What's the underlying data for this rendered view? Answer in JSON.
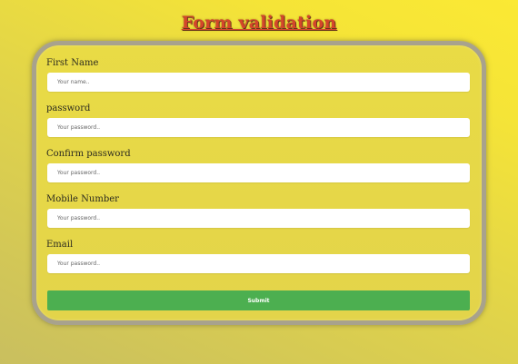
{
  "header": {
    "title": "Form validation"
  },
  "form": {
    "fields": [
      {
        "label": "First Name",
        "placeholder": "Your name.."
      },
      {
        "label": "password",
        "placeholder": "Your password.."
      },
      {
        "label": "Confirm password",
        "placeholder": "Your password.."
      },
      {
        "label": "Mobile Number",
        "placeholder": "Your password.."
      },
      {
        "label": "Email",
        "placeholder": "Your password.."
      }
    ],
    "submit_label": "Submit"
  },
  "colors": {
    "title": "#d4462b",
    "submit": "#4caf50",
    "background": "#e3d44a"
  }
}
